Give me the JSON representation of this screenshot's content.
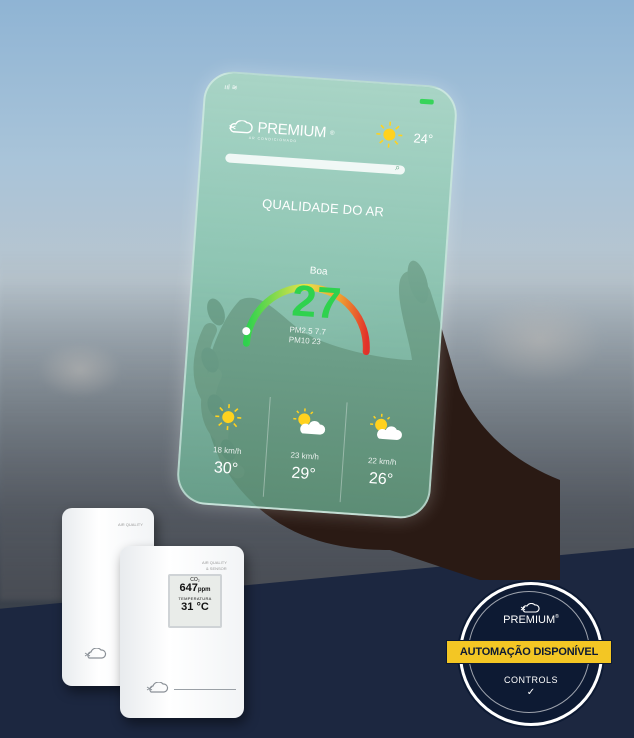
{
  "phone": {
    "signal": "ııl ≋",
    "brand": "PREMIUM",
    "brand_reg": "®",
    "brand_sub": "AR CONDICIONADO",
    "top_temp": "24°",
    "air_quality_title": "QUALIDADE DO AR",
    "gauge_label": "Boa",
    "gauge_value": "27",
    "pm25": "PM2.5  7.7",
    "pm10": "PM10  23",
    "forecast": [
      {
        "wind": "18 km/h",
        "temp": "30°"
      },
      {
        "wind": "23 km/h",
        "temp": "29°"
      },
      {
        "wind": "22 km/h",
        "temp": "26°"
      }
    ]
  },
  "device": {
    "co2_label": "CO₂",
    "co2_value": "647",
    "co2_unit": "ppm",
    "temp_label": "TEMPERATURA",
    "temp_value": "31 °C",
    "small_text": "AIR QUALITY",
    "small_text2": "& SENSOR"
  },
  "badge": {
    "brand": "PREMIUM",
    "brand_reg": "®",
    "ribbon": "AUTOMAÇÃO DISPONÍVEL",
    "controls": "CONTROLS",
    "check": "✓"
  },
  "colors": {
    "gauge_green": "#2fd24e",
    "ribbon_yellow": "#f3c624",
    "navy": "#1c2740"
  }
}
